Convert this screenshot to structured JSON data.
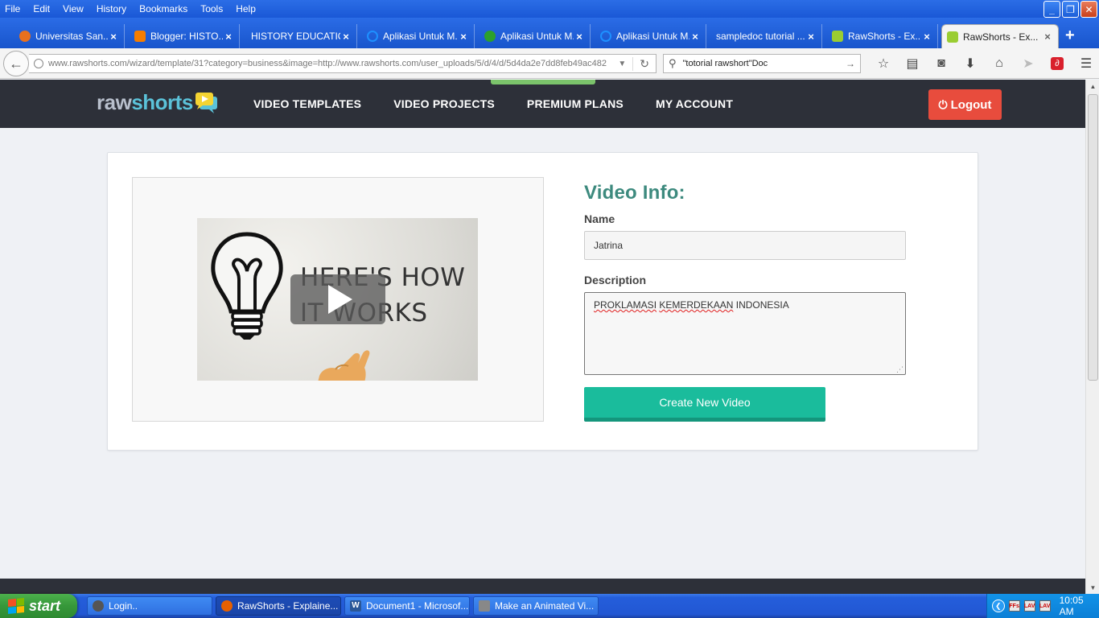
{
  "menubar": {
    "items": [
      "File",
      "Edit",
      "View",
      "History",
      "Bookmarks",
      "Tools",
      "Help"
    ]
  },
  "tabs": [
    {
      "title": "Universitas San...",
      "icon_color": "#e8701e",
      "active": false
    },
    {
      "title": "Blogger: HISTO...",
      "icon_color": "#f57d00",
      "active": false
    },
    {
      "title": "HISTORY EDUCATION",
      "icon_color": "",
      "active": false
    },
    {
      "title": "Aplikasi Untuk M...",
      "icon_color": "#1e90ff",
      "active": false
    },
    {
      "title": "Aplikasi Untuk M...",
      "icon_color": "#2ca02c",
      "active": false
    },
    {
      "title": "Aplikasi Untuk M...",
      "icon_color": "#1e90ff",
      "active": false
    },
    {
      "title": "sampledoc tutorial ...",
      "icon_color": "",
      "active": false
    },
    {
      "title": "RawShorts - Ex...",
      "icon_color": "#9acd32",
      "active": false
    },
    {
      "title": "RawShorts - Ex...",
      "icon_color": "#9acd32",
      "active": true
    }
  ],
  "navbar": {
    "url": "www.rawshorts.com/wizard/template/31?category=business&image=http://www.rawshorts.com/user_uploads/5/d/4/d/5d4da2e7dd8feb49ac482",
    "search_value": "\"totorial rawshort\"Doc"
  },
  "site": {
    "logo_part1": "raw",
    "logo_part2": "shorts",
    "nav": [
      "VIDEO TEMPLATES",
      "VIDEO PROJECTS",
      "PREMIUM PLANS",
      "MY ACCOUNT"
    ],
    "logout_label": "Logout"
  },
  "video": {
    "thumb_line1": "HERE'S HOW",
    "thumb_line2": "IT WORKS"
  },
  "form": {
    "title": "Video Info:",
    "name_label": "Name",
    "name_value": "Jatrina",
    "description_label": "Description",
    "description_word1": "PROKLAMASI",
    "description_word2": "KEMERDEKAAN",
    "description_word3": "INDONESIA",
    "create_button": "Create New Video"
  },
  "taskbar": {
    "start_label": "start",
    "items": [
      {
        "label": "Login..",
        "icon_color": "#555555",
        "active": false
      },
      {
        "label": "RawShorts - Explaine...",
        "icon_color": "#e66000",
        "active": true
      },
      {
        "label": "Document1 - Microsof...",
        "icon_color": "#2b5797",
        "active": false
      },
      {
        "label": "Make an Animated Vi...",
        "icon_color": "#888888",
        "active": false
      }
    ],
    "tray_icons": [
      "FFs",
      "LAV",
      "LAV"
    ],
    "clock": "10:05 AM"
  },
  "colors": {
    "accent_teal": "#1abc9c",
    "logout_red": "#e84c3d",
    "header_dark": "#2d3039",
    "title_green": "#3d8a7e"
  }
}
